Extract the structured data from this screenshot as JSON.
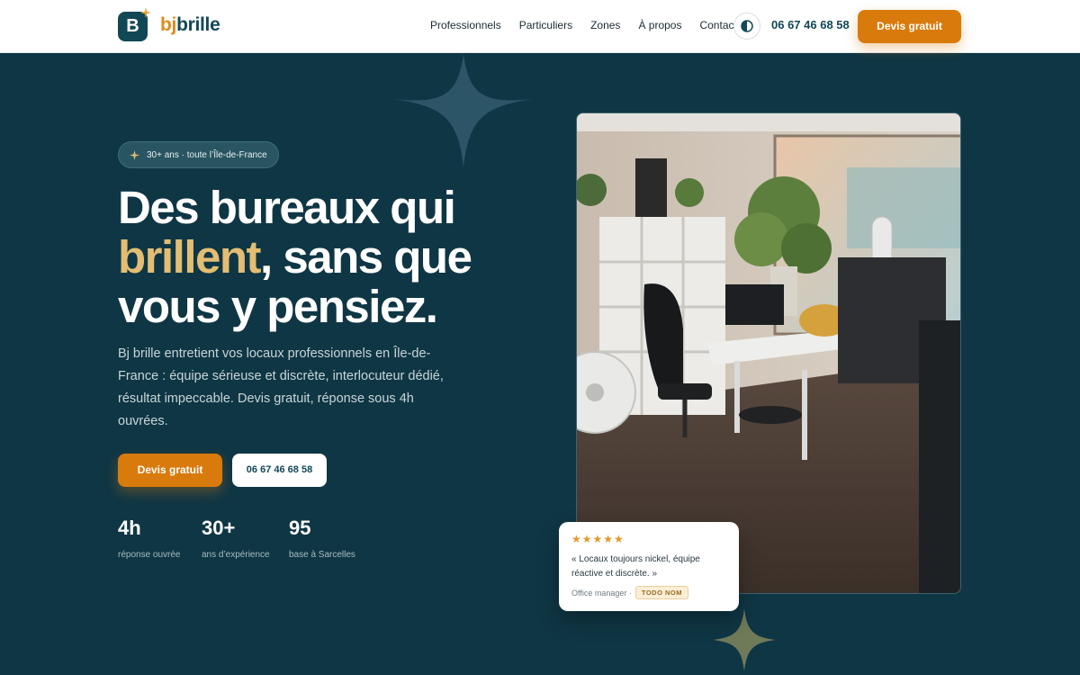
{
  "brand": {
    "logo_letter": "B",
    "name_part1": "bj",
    "name_part2": "brille"
  },
  "nav": {
    "items": [
      "Professionnels",
      "Particuliers",
      "Zones",
      "À propos",
      "Contact"
    ]
  },
  "header": {
    "phone": "06 67 46 68 58",
    "cta": "Devis gratuit"
  },
  "hero": {
    "badge": "30+ ans · toute l’Île-de-France",
    "headline_line1": "Des bureaux qui",
    "headline_highlight": "brillent",
    "headline_rest1": ", sans que",
    "headline_line3": "vous y pensiez.",
    "description": "Bj brille entretient vos locaux professionnels en Île-de-France : équipe sérieuse et discrète, interlocuteur dédié, résultat impeccable. Devis gratuit, réponse sous 4h ouvrées.",
    "cta_primary": "Devis gratuit",
    "cta_secondary": "06 67 46 68 58",
    "stats": [
      {
        "value": "4h",
        "label": "réponse ouvrée"
      },
      {
        "value": "30+",
        "label": "ans d’expérience"
      },
      {
        "value": "95",
        "label": "base à Sarcelles"
      }
    ]
  },
  "review": {
    "stars": "★★★★★",
    "quote": "« Locaux toujours nickel, équipe réactive et discrète. »",
    "role": "Office manager ·",
    "tag": "TODO NOM"
  },
  "colors": {
    "accent": "#d97a0c",
    "highlight": "#e3bd73",
    "background": "#0f3644",
    "brand_dark": "#124756"
  }
}
